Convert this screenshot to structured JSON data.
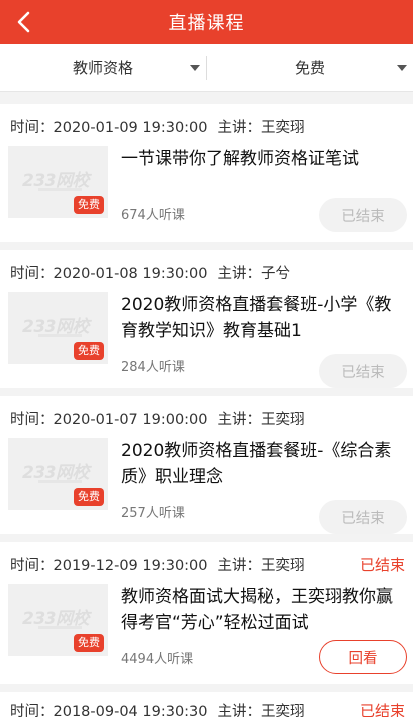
{
  "header": {
    "title": "直播课程"
  },
  "filters": {
    "category": "教师资格",
    "price": "免费"
  },
  "labels": {
    "time_prefix": "时间：",
    "speaker_prefix": "主讲：",
    "listen_suffix": "人听课",
    "free_badge": "免费",
    "watermark": "233网校"
  },
  "courses": [
    {
      "time": "2020-01-09 19:30:00",
      "speaker": "王奕珝",
      "title": "一节课带你了解教师资格证笔试",
      "listeners": "674",
      "status_label": "",
      "button": "已结束",
      "button_type": "ended"
    },
    {
      "time": "2020-01-08 19:30:00",
      "speaker": "子兮",
      "title": "2020教师资格直播套餐班-小学《教育教学知识》教育基础1",
      "listeners": "284",
      "status_label": "",
      "button": "已结束",
      "button_type": "ended"
    },
    {
      "time": "2020-01-07 19:00:00",
      "speaker": "王奕珝",
      "title": "2020教师资格直播套餐班-《综合素质》职业理念",
      "listeners": "257",
      "status_label": "",
      "button": "已结束",
      "button_type": "ended"
    },
    {
      "time": "2019-12-09 19:30:00",
      "speaker": "王奕珝",
      "title": "教师资格面试大揭秘，王奕珝教你赢得考官“芳心”轻松过面试",
      "listeners": "4494",
      "status_label": "已结束",
      "button": "回看",
      "button_type": "replay"
    },
    {
      "time": "2018-09-04 19:30:30",
      "speaker": "王奕珝",
      "title": "",
      "listeners": "",
      "status_label": "已结束",
      "button": "",
      "button_type": ""
    }
  ],
  "colors": {
    "brand": "#e8412c",
    "ended_bg": "#f2f2f2",
    "ended_text": "#bbbbbb"
  },
  "icons": {
    "back": "chevron-left-icon",
    "dropdown": "caret-down-icon"
  }
}
